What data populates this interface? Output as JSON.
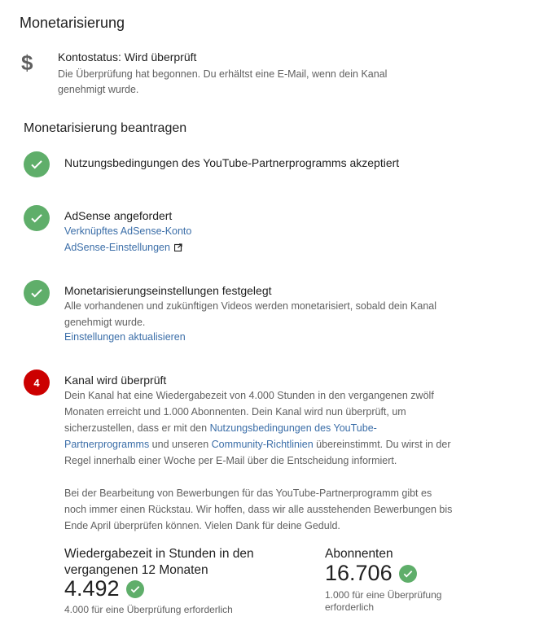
{
  "page_title": "Monetarisierung",
  "account": {
    "icon": "dollar-icon",
    "status": "Kontostatus: Wird überprüft",
    "description": "Die Überprüfung hat begonnen. Du erhältst eine E-Mail, wenn dein Kanal genehmigt wurde."
  },
  "apply_heading": "Monetarisierung beantragen",
  "steps": [
    {
      "state": "done",
      "title": "Nutzungsbedingungen des YouTube-Partnerprogramms akzeptiert"
    },
    {
      "state": "done",
      "title": "AdSense angefordert",
      "link1": "Verknüpftes AdSense-Konto",
      "link2": "AdSense-Einstellungen"
    },
    {
      "state": "done",
      "title": "Monetarisierungseinstellungen festgelegt",
      "description": "Alle vorhandenen und zukünftigen Videos werden monetarisiert, sobald dein Kanal genehmigt wurde.",
      "link": "Einstellungen aktualisieren"
    },
    {
      "state": "pending",
      "number": "4",
      "title": "Kanal wird überprüft",
      "p1_a": "Dein Kanal hat eine Wiedergabezeit von 4.000 Stunden in den vergangenen zwölf Monaten erreicht und 1.000 Abonnenten. Dein Kanal wird nun überprüft, um sicherzustellen, dass er mit den ",
      "p1_link1": "Nutzungsbedingungen des YouTube-Partnerprogramms",
      "p1_b": " und unseren ",
      "p1_link2": "Community-Richtlinien",
      "p1_c": " übereinstimmt. Du wirst in der Regel innerhalb einer Woche per E-Mail über die Entscheidung informiert.",
      "p2": "Bei der Bearbeitung von Bewerbungen für das YouTube-Partnerprogramm gibt es noch immer einen Rückstau. Wir hoffen, dass wir alle ausstehenden Bewerbungen bis Ende April überprüfen können. Vielen Dank für deine Geduld."
    }
  ],
  "stats": {
    "watch_time": {
      "label": "Wiedergabezeit in Stunden in den vergangenen 12 Monaten",
      "value": "4.492",
      "note": "4.000 für eine Überprüfung erforderlich"
    },
    "subscribers": {
      "label": "Abonnenten",
      "value": "16.706",
      "note": "1.000 für eine Überprüfung erforderlich"
    }
  },
  "colors": {
    "check_green": "#5fae6a",
    "pending_red": "#cc0000",
    "link_blue": "#3b6ea8"
  }
}
